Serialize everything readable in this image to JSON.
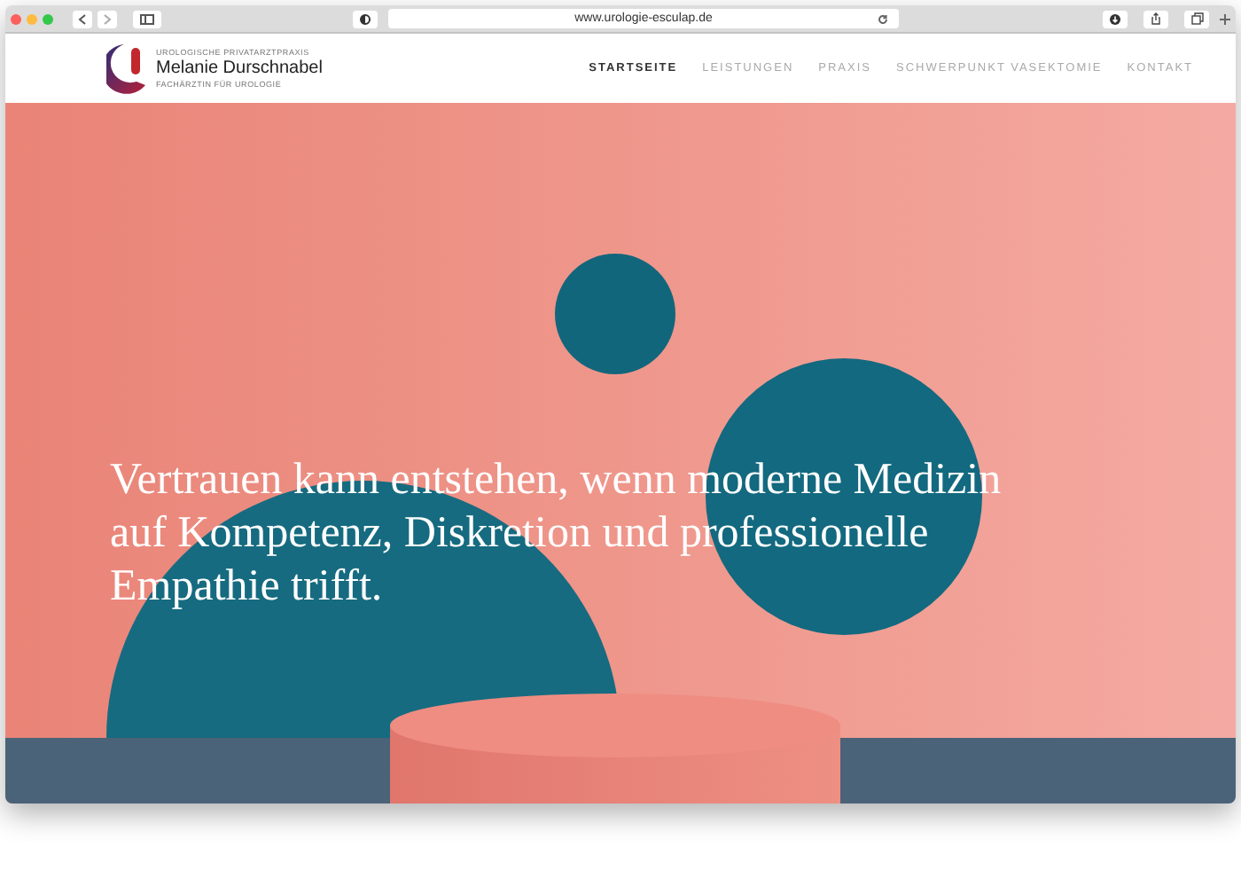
{
  "browser": {
    "url": "www.urologie-esculap.de"
  },
  "site_header": {
    "tagline": "UROLOGISCHE PRIVATARZTPRAXIS",
    "name": "Melanie Durschnabel",
    "subtitle": "FACHÄRZTIN FÜR UROLOGIE"
  },
  "nav": [
    {
      "label": "STARTSEITE",
      "selected": true
    },
    {
      "label": "LEISTUNGEN",
      "selected": false
    },
    {
      "label": "PRAXIS",
      "selected": false
    },
    {
      "label": "SCHWERPUNKT VASEKTOMIE",
      "selected": false
    },
    {
      "label": "KONTAKT",
      "selected": false
    }
  ],
  "hero": {
    "headline": "Vertrauen kann entstehen, wenn moderne Medizin auf Kompetenz, Diskretion und professionelle Empathie trifft."
  }
}
